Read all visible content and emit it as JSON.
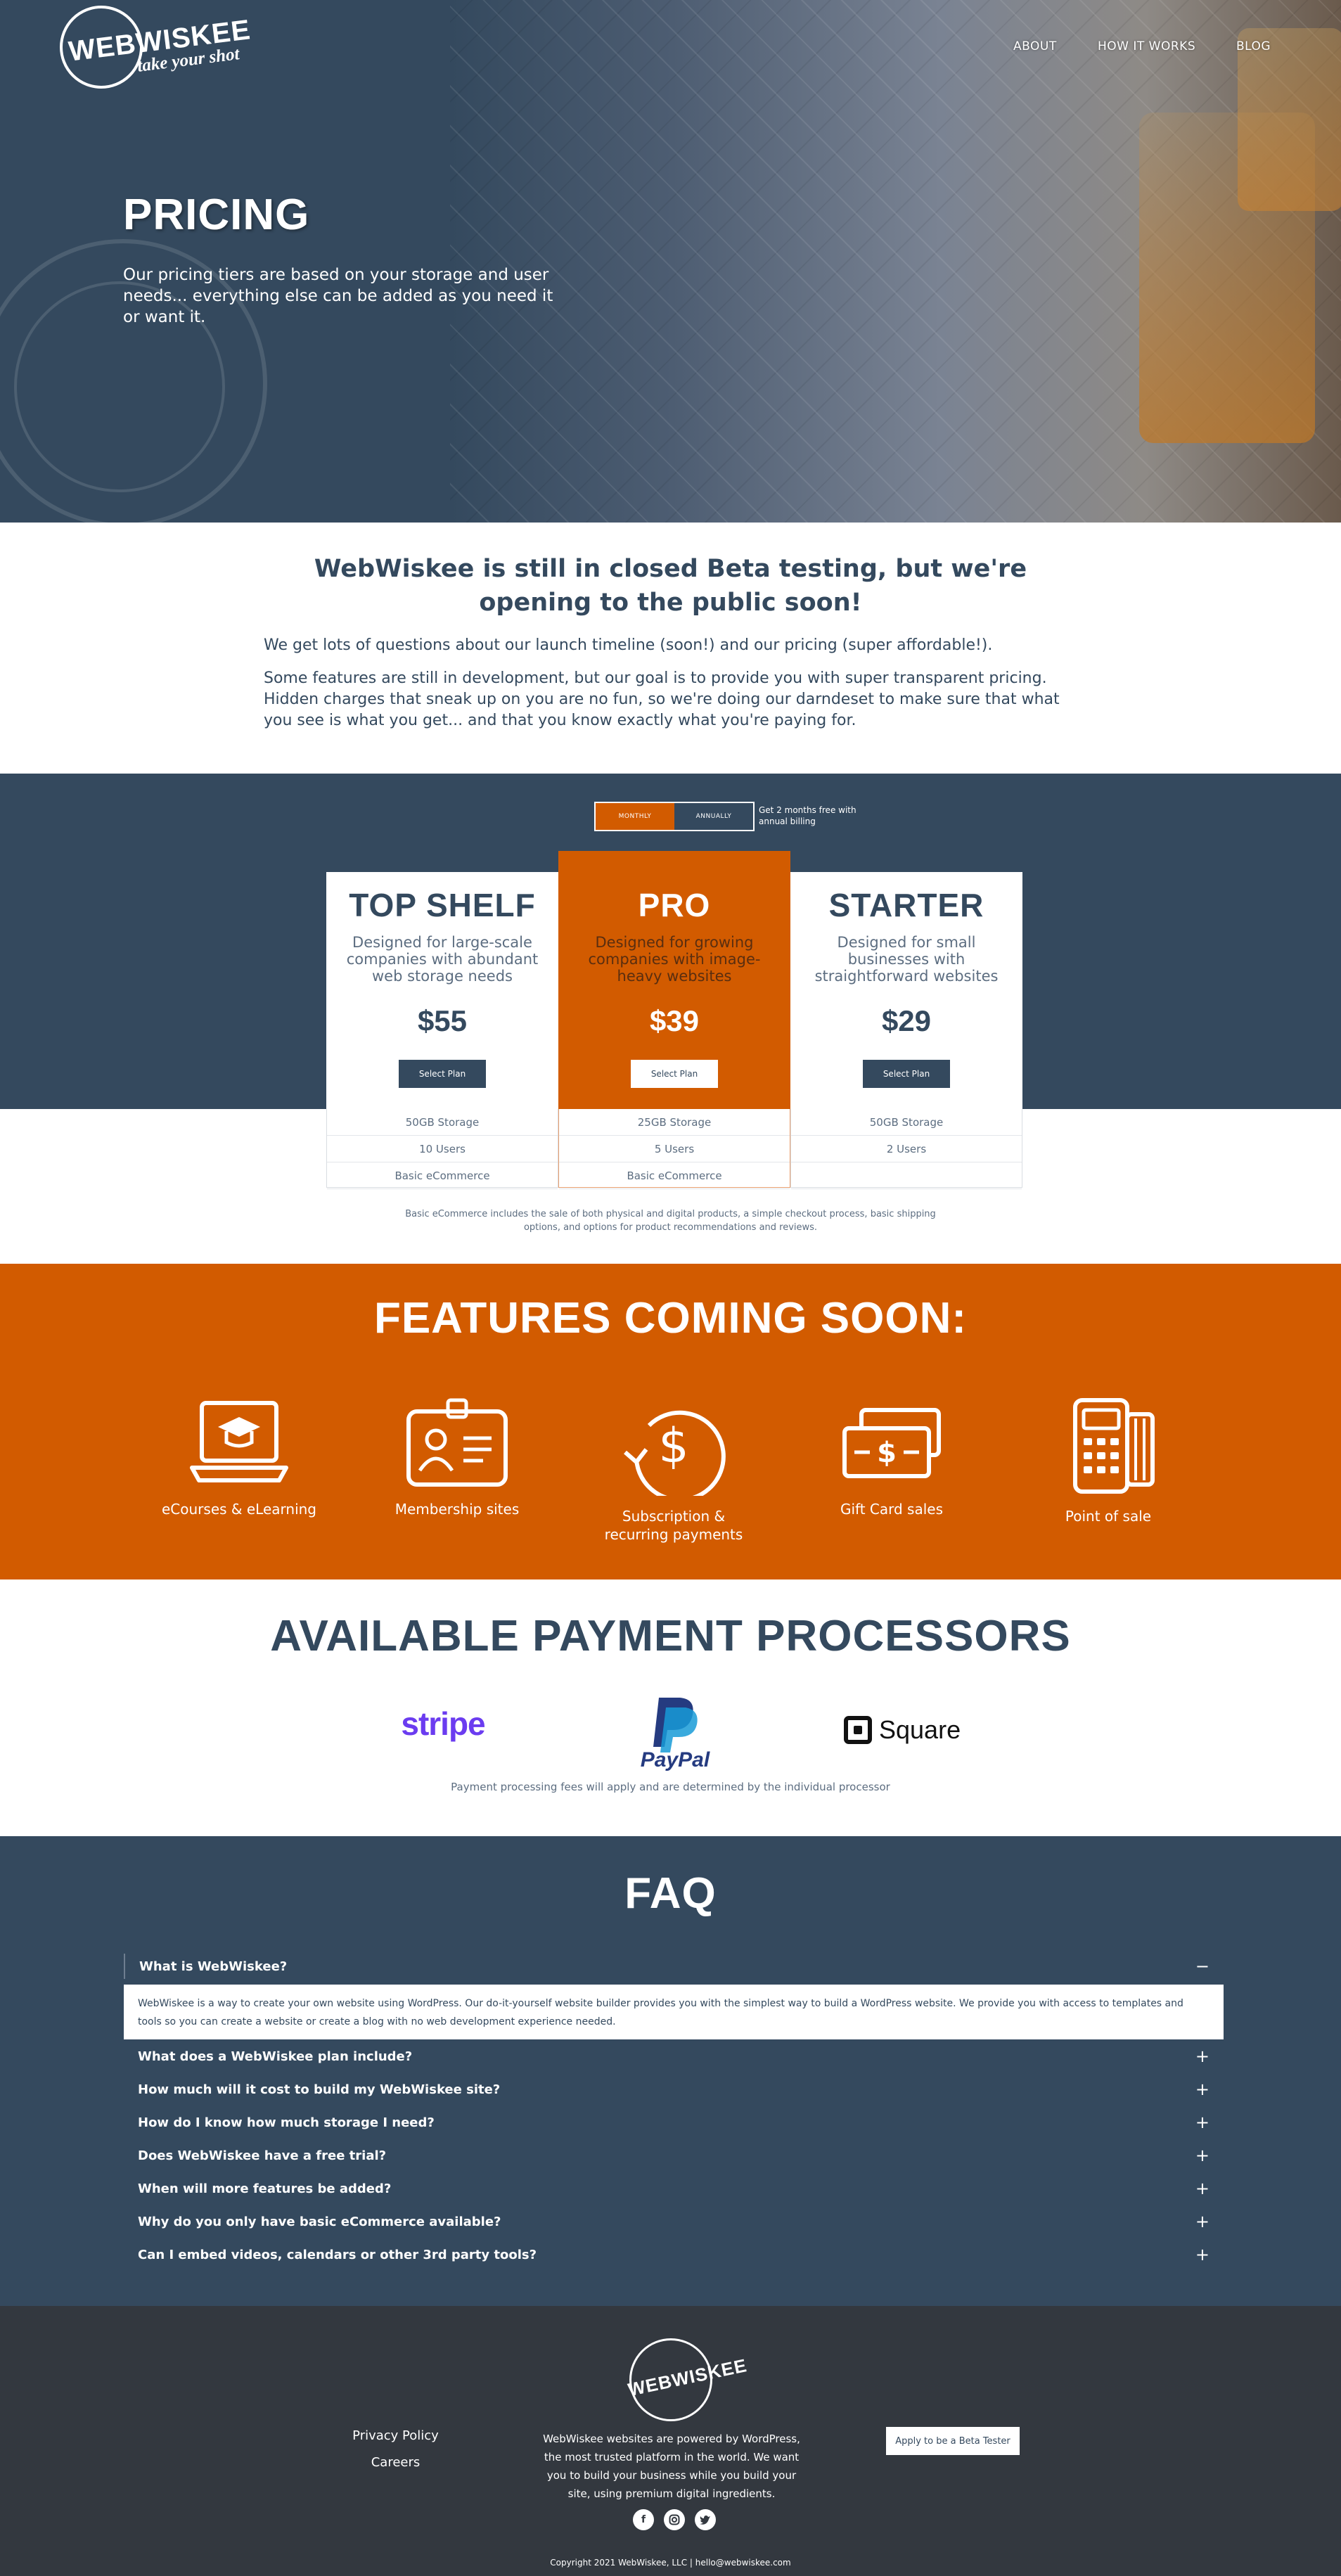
{
  "header": {
    "logo_text": "WEBWISKEE",
    "logo_tagline": "take your shot",
    "nav": [
      "ABOUT",
      "HOW IT WORKS",
      "BLOG"
    ]
  },
  "hero": {
    "title": "PRICING",
    "subtitle": "Our pricing tiers are based on your storage and user needs... everything else can be added as you need it or want it."
  },
  "beta": {
    "heading": "WebWiskee is still in closed Beta testing, but we're opening to the public soon!",
    "p1": "We get lots of questions about our launch timeline (soon!) and our pricing (super affordable!).",
    "p2": "Some features are still in development, but our goal is to provide you with super transparent pricing. Hidden charges that sneak up on you are no fun, so we're doing our darndeset to make sure that what you see is what you get... and that you know exactly what you're paying for."
  },
  "pricing": {
    "toggle": {
      "monthly": "MONTHLY",
      "annually": "ANNUALLY"
    },
    "toggle_note": "Get 2 months free with annual billing",
    "plans": [
      {
        "name": "TOP SHELF",
        "desc": "Designed for large-scale companies with abundant web storage needs",
        "price": "$55",
        "button": "Select Plan",
        "features": [
          "50GB Storage",
          "10 Users",
          "Basic eCommerce"
        ]
      },
      {
        "name": "PRO",
        "desc": "Designed for growing companies with image-heavy websites",
        "price": "$39",
        "button": "Select Plan",
        "features": [
          "25GB Storage",
          "5 Users",
          "Basic eCommerce"
        ]
      },
      {
        "name": "STARTER",
        "desc": "Designed for small businesses with straightforward websites",
        "price": "$29",
        "button": "Select Plan",
        "features": [
          "50GB Storage",
          "2 Users",
          ""
        ]
      }
    ],
    "note": "Basic eCommerce includes the sale of both physical and digital products, a simple checkout process, basic shipping options, and options for product recommendations and reviews."
  },
  "features": {
    "heading": "FEATURES COMING SOON:",
    "items": [
      {
        "label": "eCourses & eLearning",
        "icon": "laptop-graduation-cap-icon"
      },
      {
        "label": "Membership sites",
        "icon": "id-badge-icon"
      },
      {
        "label": "Subscription & recurring payments",
        "icon": "recurring-dollar-icon"
      },
      {
        "label": "Gift Card sales",
        "icon": "cash-bills-icon"
      },
      {
        "label": "Point of sale",
        "icon": "card-reader-icon"
      }
    ]
  },
  "processors": {
    "heading": "AVAILABLE PAYMENT PROCESSORS",
    "logos": {
      "stripe": "stripe",
      "paypal": "PayPal",
      "square": "Square"
    },
    "note": "Payment processing fees will apply and are determined by the individual processor"
  },
  "faq": {
    "heading": "FAQ",
    "open_question": "What is WebWiskee?",
    "open_answer": "WebWiskee is a way to create your own website using WordPress. Our do-it-yourself website builder provides you with the simplest way to build a WordPress website. We provide you with access to templates and tools so you can create a website or create a blog with no web development experience needed.",
    "questions": [
      "What does a WebWiskee plan include?",
      "How much will it cost to build my WebWiskee site?",
      "How do I know how much storage I need?",
      "Does WebWiskee have a free trial?",
      "When will more features be added?",
      "Why do you only have basic eCommerce available?",
      "Can I embed videos, calendars or other 3rd party tools?"
    ],
    "collapse_icon": "−",
    "expand_icon": "+"
  },
  "footer": {
    "logo_text": "WEBWISKEE",
    "links": [
      "Privacy Policy",
      "Careers"
    ],
    "description": "WebWiskee websites are powered by WordPress, the most trusted platform in the world. We want you to build your business while you build your site, using premium digital ingredients.",
    "cta": "Apply to be a Beta Tester",
    "social": [
      "facebook-icon",
      "instagram-icon",
      "twitter-icon"
    ],
    "copyright": "Copyright 2021 WebWiskee, LLC   |   hello@webwiskee.com"
  },
  "colors": {
    "navy": "#34495e",
    "orange": "#d25b00",
    "footer": "#33383f"
  }
}
